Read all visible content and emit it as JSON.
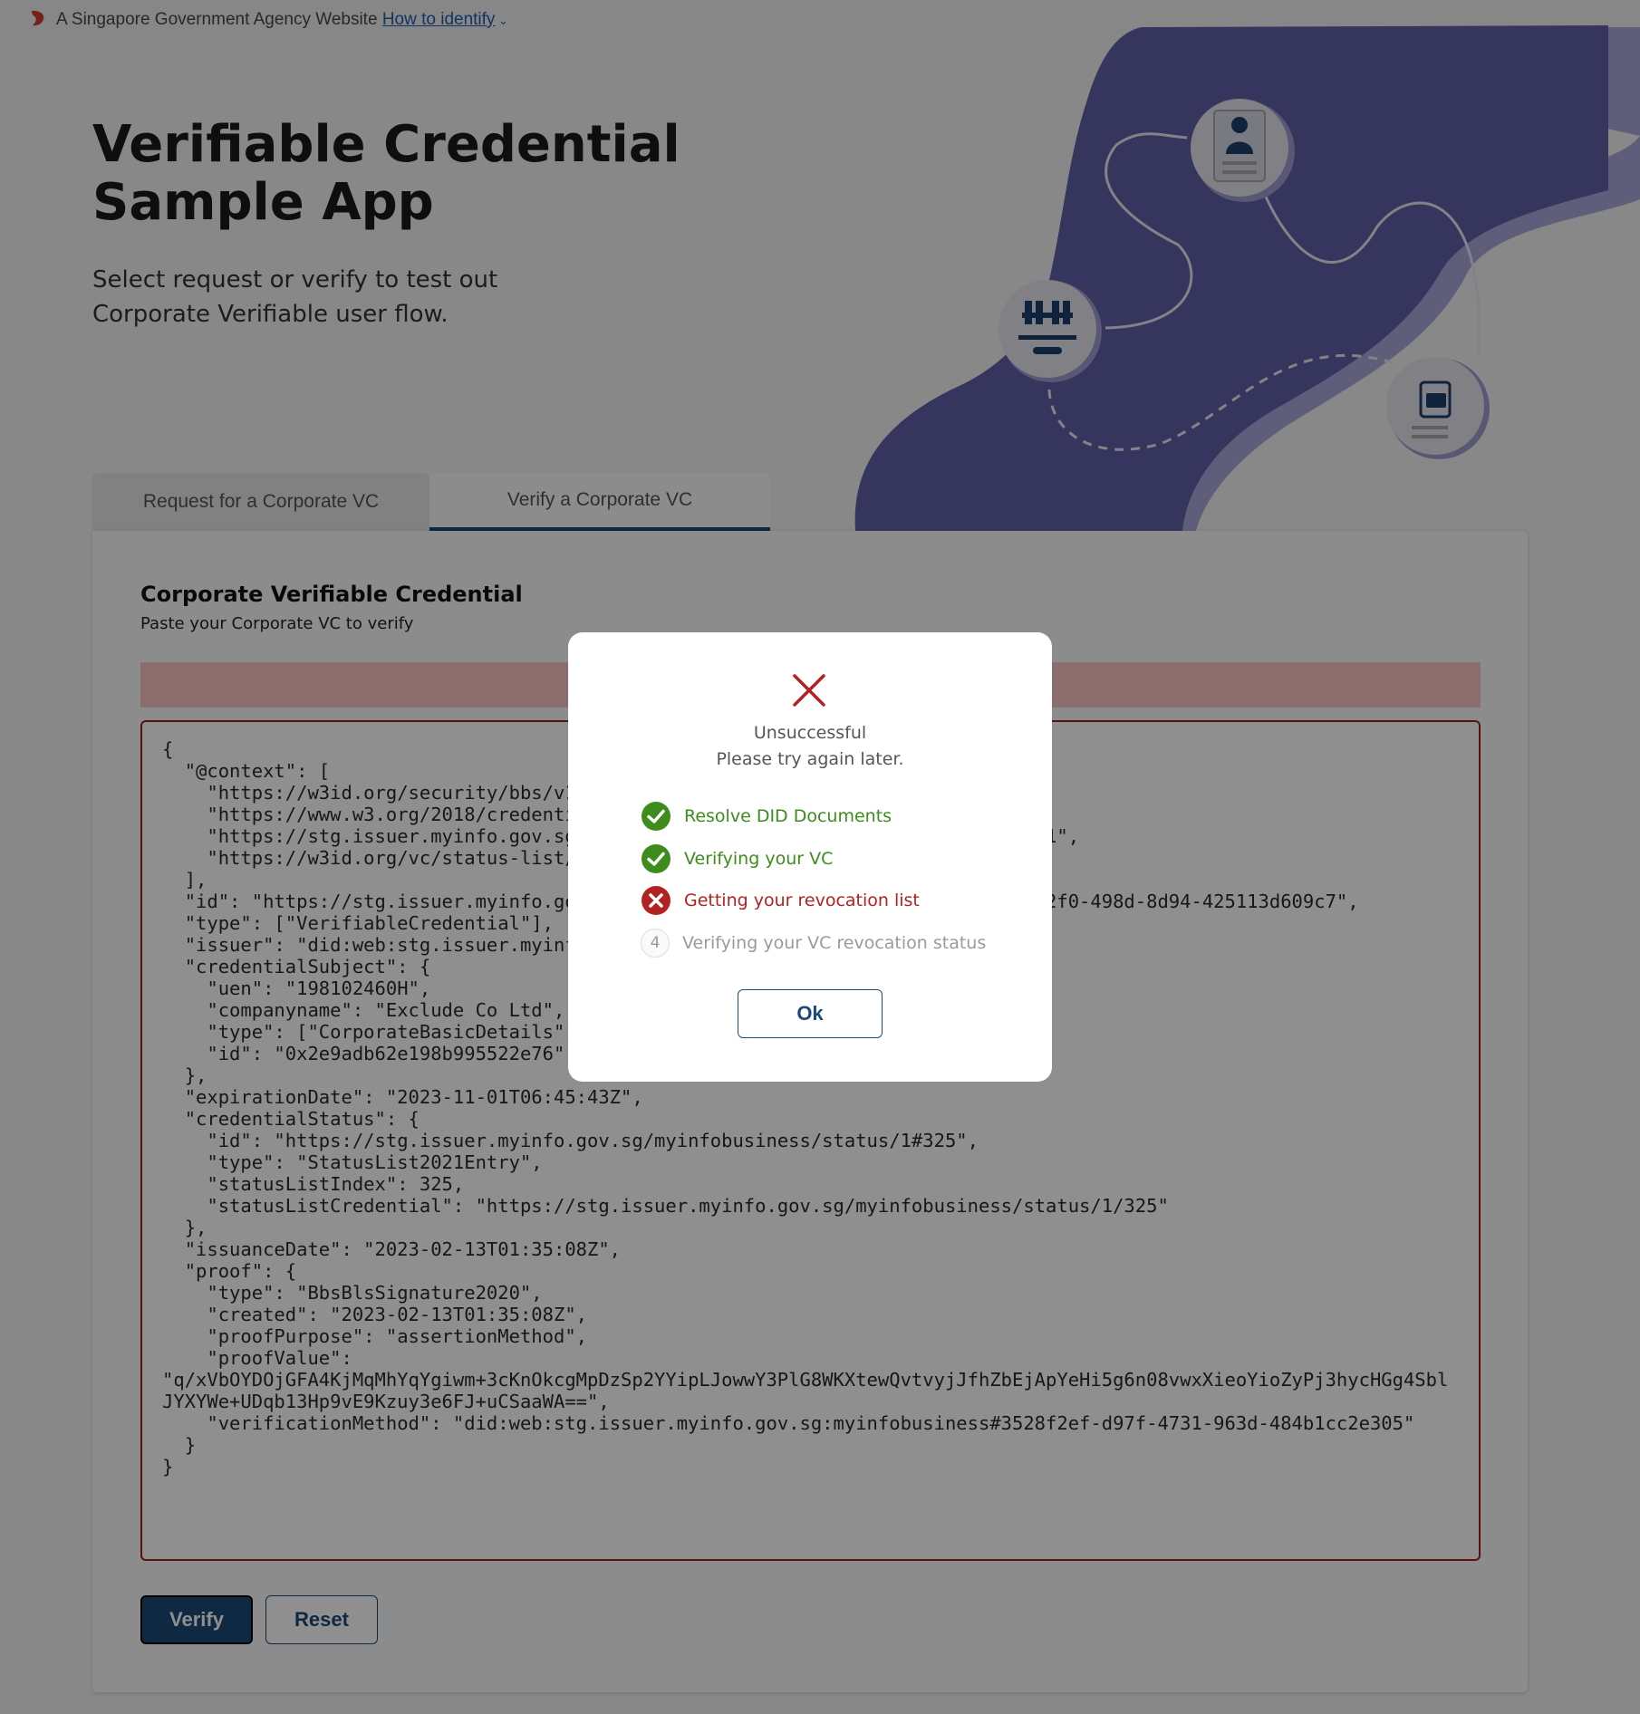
{
  "masthead": {
    "text": "A Singapore Government Agency Website",
    "link": "How to identify"
  },
  "hero": {
    "title_line1": "Verifiable Credential",
    "title_line2": "Sample App",
    "subtitle_line1": "Select request or verify to test out",
    "subtitle_line2": "Corporate Verifiable user flow."
  },
  "tabs": [
    {
      "label": "Request for a Corporate VC"
    },
    {
      "label": "Verify a Corporate VC"
    }
  ],
  "card": {
    "title": "Corporate Verifiable Credential",
    "subtitle": "Paste your Corporate VC to verify"
  },
  "vc_json": "{\n  \"@context\": [\n    \"https://w3id.org/security/bbs/v1\",\n    \"https://www.w3.org/2018/credentials/v1\",\n    \"https://stg.issuer.myinfo.gov.sg/myinfobusiness/vc/corporatebasicdetails/v1\",\n    \"https://w3id.org/vc/status-list/2021/v1\"\n  ],\n  \"id\": \"https://stg.issuer.myinfo.gov.sg/myinfobusiness/credentials/2e8d1b3c-72f0-498d-8d94-425113d609c7\",\n  \"type\": [\"VerifiableCredential\"],\n  \"issuer\": \"did:web:stg.issuer.myinfo.gov.sg:myinfobusiness\",\n  \"credentialSubject\": {\n    \"uen\": \"198102460H\",\n    \"companyname\": \"Exclude Co Ltd\",\n    \"type\": [\"CorporateBasicDetails\"],\n    \"id\": \"0x2e9adb62e198b995522e76\"\n  },\n  \"expirationDate\": \"2023-11-01T06:45:43Z\",\n  \"credentialStatus\": {\n    \"id\": \"https://stg.issuer.myinfo.gov.sg/myinfobusiness/status/1#325\",\n    \"type\": \"StatusList2021Entry\",\n    \"statusListIndex\": 325,\n    \"statusListCredential\": \"https://stg.issuer.myinfo.gov.sg/myinfobusiness/status/1/325\"\n  },\n  \"issuanceDate\": \"2023-02-13T01:35:08Z\",\n  \"proof\": {\n    \"type\": \"BbsBlsSignature2020\",\n    \"created\": \"2023-02-13T01:35:08Z\",\n    \"proofPurpose\": \"assertionMethod\",\n    \"proofValue\":\n\"q/xVbOYDOjGFA4KjMqMhYqYgiwm+3cKnOkcgMpDzSp2YYipLJowwY3PlG8WKXtewQvtvyjJfhZbEjApYeHi5g6n08vwxXieoYioZyPj3hycHGg4SblJYXYWe+UDqb13Hp9vE9Kzuy3e6FJ+uCSaaWA==\",\n    \"verificationMethod\": \"did:web:stg.issuer.myinfo.gov.sg:myinfobusiness#3528f2ef-d97f-4731-963d-484b1cc2e305\"\n  }\n}",
  "buttons": {
    "verify": "Verify",
    "reset": "Reset"
  },
  "modal": {
    "title": "Unsuccessful",
    "description": "Please try again later.",
    "steps": [
      {
        "label": "Resolve DID Documents",
        "status": "done"
      },
      {
        "label": "Verifying your VC",
        "status": "done"
      },
      {
        "label": "Getting your revocation list",
        "status": "failed"
      },
      {
        "label": "Verifying your VC revocation status",
        "status": "pending",
        "number": "4"
      }
    ],
    "ok": "Ok"
  },
  "colors": {
    "primary": "#1c4978",
    "success": "#3d8c1c",
    "error": "#b22222",
    "hero_blob": "#5f5fa8"
  },
  "icons": {
    "masthead": "lion-head-icon",
    "modal_status": "close-icon",
    "step_done": "check-circle-icon",
    "step_failed": "x-circle-icon"
  }
}
